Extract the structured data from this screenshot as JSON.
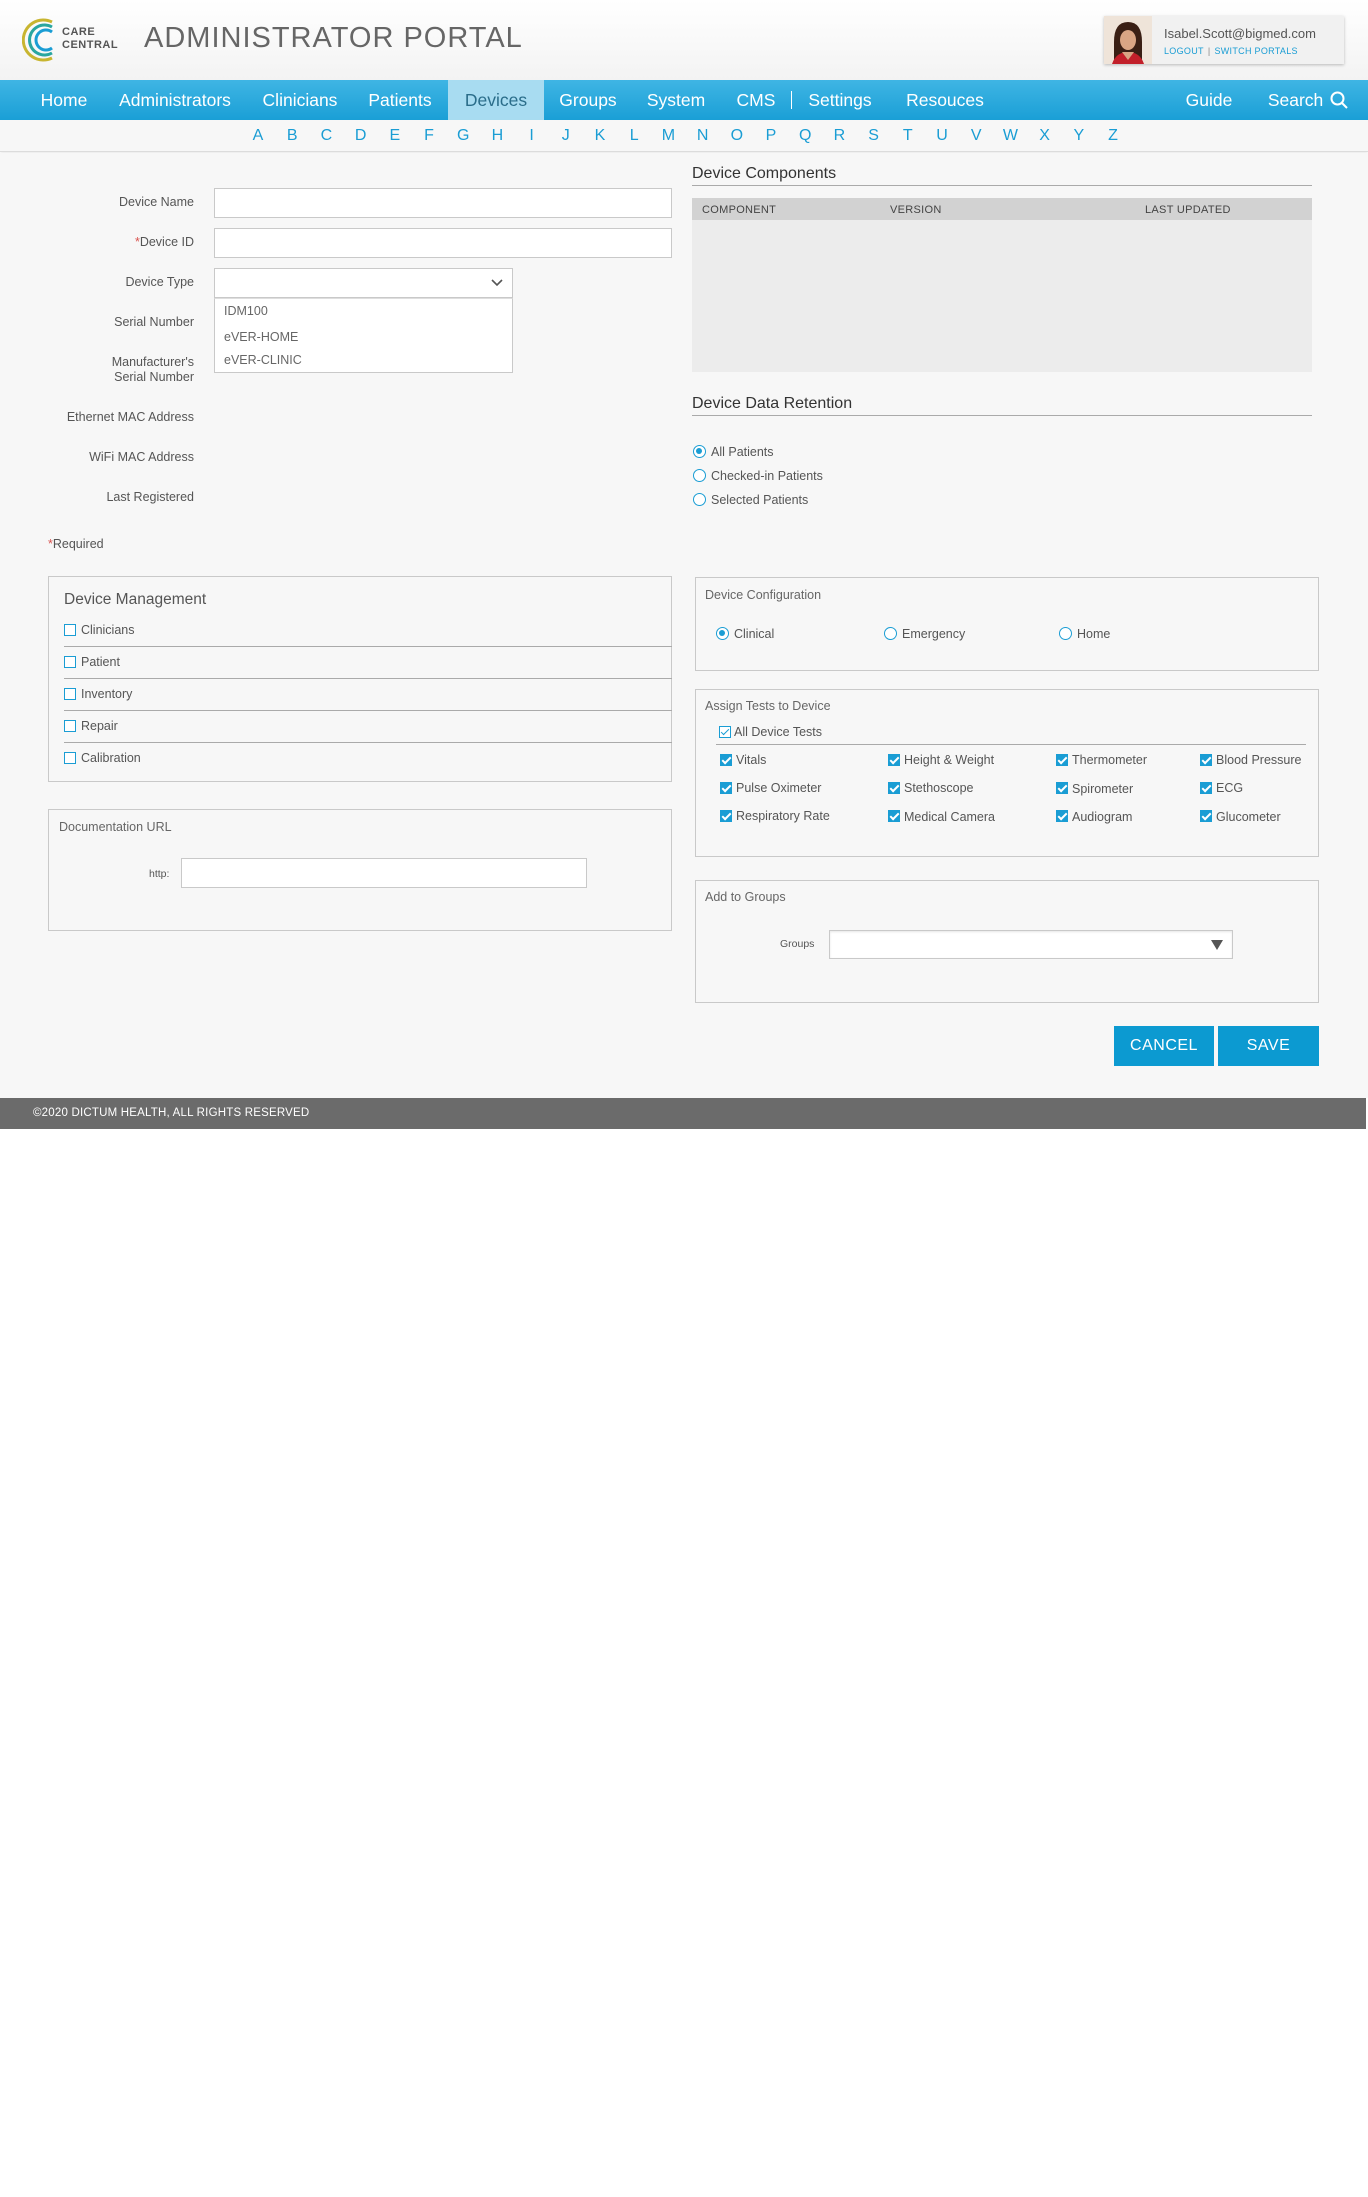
{
  "header": {
    "logo_text_line1": "CARE",
    "logo_text_line2": "CENTRAL",
    "portal_title": "ADMINISTRATOR PORTAL",
    "user_email": "Isabel.Scott@bigmed.com",
    "logout_label": "LOGOUT",
    "links_separator": "|",
    "switch_portals_label": "SWITCH PORTALS"
  },
  "nav": {
    "items": [
      "Home",
      "Administrators",
      "Clinicians",
      "Patients",
      "Devices",
      "Groups",
      "System",
      "CMS",
      "Settings",
      "Resouces"
    ],
    "active": "Devices",
    "guide_label": "Guide",
    "search_label": "Search"
  },
  "alphabet": [
    "A",
    "B",
    "C",
    "D",
    "E",
    "F",
    "G",
    "H",
    "I",
    "J",
    "K",
    "L",
    "M",
    "N",
    "O",
    "P",
    "Q",
    "R",
    "S",
    "T",
    "U",
    "V",
    "W",
    "X",
    "Y",
    "Z"
  ],
  "form": {
    "device_name_label": "Device Name",
    "device_name_value": "",
    "device_id_label": "Device ID",
    "device_id_required_mark": "*",
    "device_id_value": "",
    "device_type_label": "Device Type",
    "device_type_value": "",
    "device_type_options": [
      "IDM100",
      "eVER-HOME",
      "eVER-CLINIC"
    ],
    "serial_number_label": "Serial Number",
    "manufacturer_serial_label_line1": "Manufacturer's",
    "manufacturer_serial_label_line2": "Serial Number",
    "ethernet_mac_label": "Ethernet MAC Address",
    "wifi_mac_label": "WiFi MAC Address",
    "last_registered_label": "Last Registered",
    "required_mark": "*",
    "required_note": "Required"
  },
  "components": {
    "title": "Device Components",
    "columns": [
      "COMPONENT",
      "VERSION",
      "LAST UPDATED"
    ],
    "rows": []
  },
  "retention": {
    "title": "Device Data Retention",
    "options": [
      "All Patients",
      "Checked-in Patients",
      "Selected Patients"
    ],
    "selected": "All Patients"
  },
  "management": {
    "title": "Device Management",
    "items": [
      "Clinicians",
      "Patient",
      "Inventory",
      "Repair",
      "Calibration"
    ]
  },
  "documentation": {
    "title": "Documentation URL",
    "prefix_label": "http:",
    "value": ""
  },
  "configuration": {
    "title": "Device Configuration",
    "options": [
      "Clinical",
      "Emergency",
      "Home"
    ],
    "selected": "Clinical"
  },
  "tests": {
    "title": "Assign Tests to Device",
    "all_label": "All Device Tests",
    "items": [
      "Vitals",
      "Height & Weight",
      "Thermometer",
      "Blood Pressure",
      "Pulse Oximeter",
      "Stethoscope",
      "Spirometer",
      "ECG",
      "Respiratory Rate",
      "Medical Camera",
      "Audiogram",
      "Glucometer"
    ]
  },
  "groups": {
    "title": "Add to Groups",
    "label": "Groups",
    "value": ""
  },
  "actions": {
    "cancel_label": "CANCEL",
    "save_label": "SAVE"
  },
  "footer": {
    "copyright": "©2020 DICTUM HEALTH, ALL RIGHTS RESERVED"
  },
  "colors": {
    "accent": "#1a9dd4",
    "nav_active_bg": "#a8dcf1",
    "button": "#0c9ad1",
    "footer": "#6b6b6b",
    "required": "#d9534f"
  }
}
